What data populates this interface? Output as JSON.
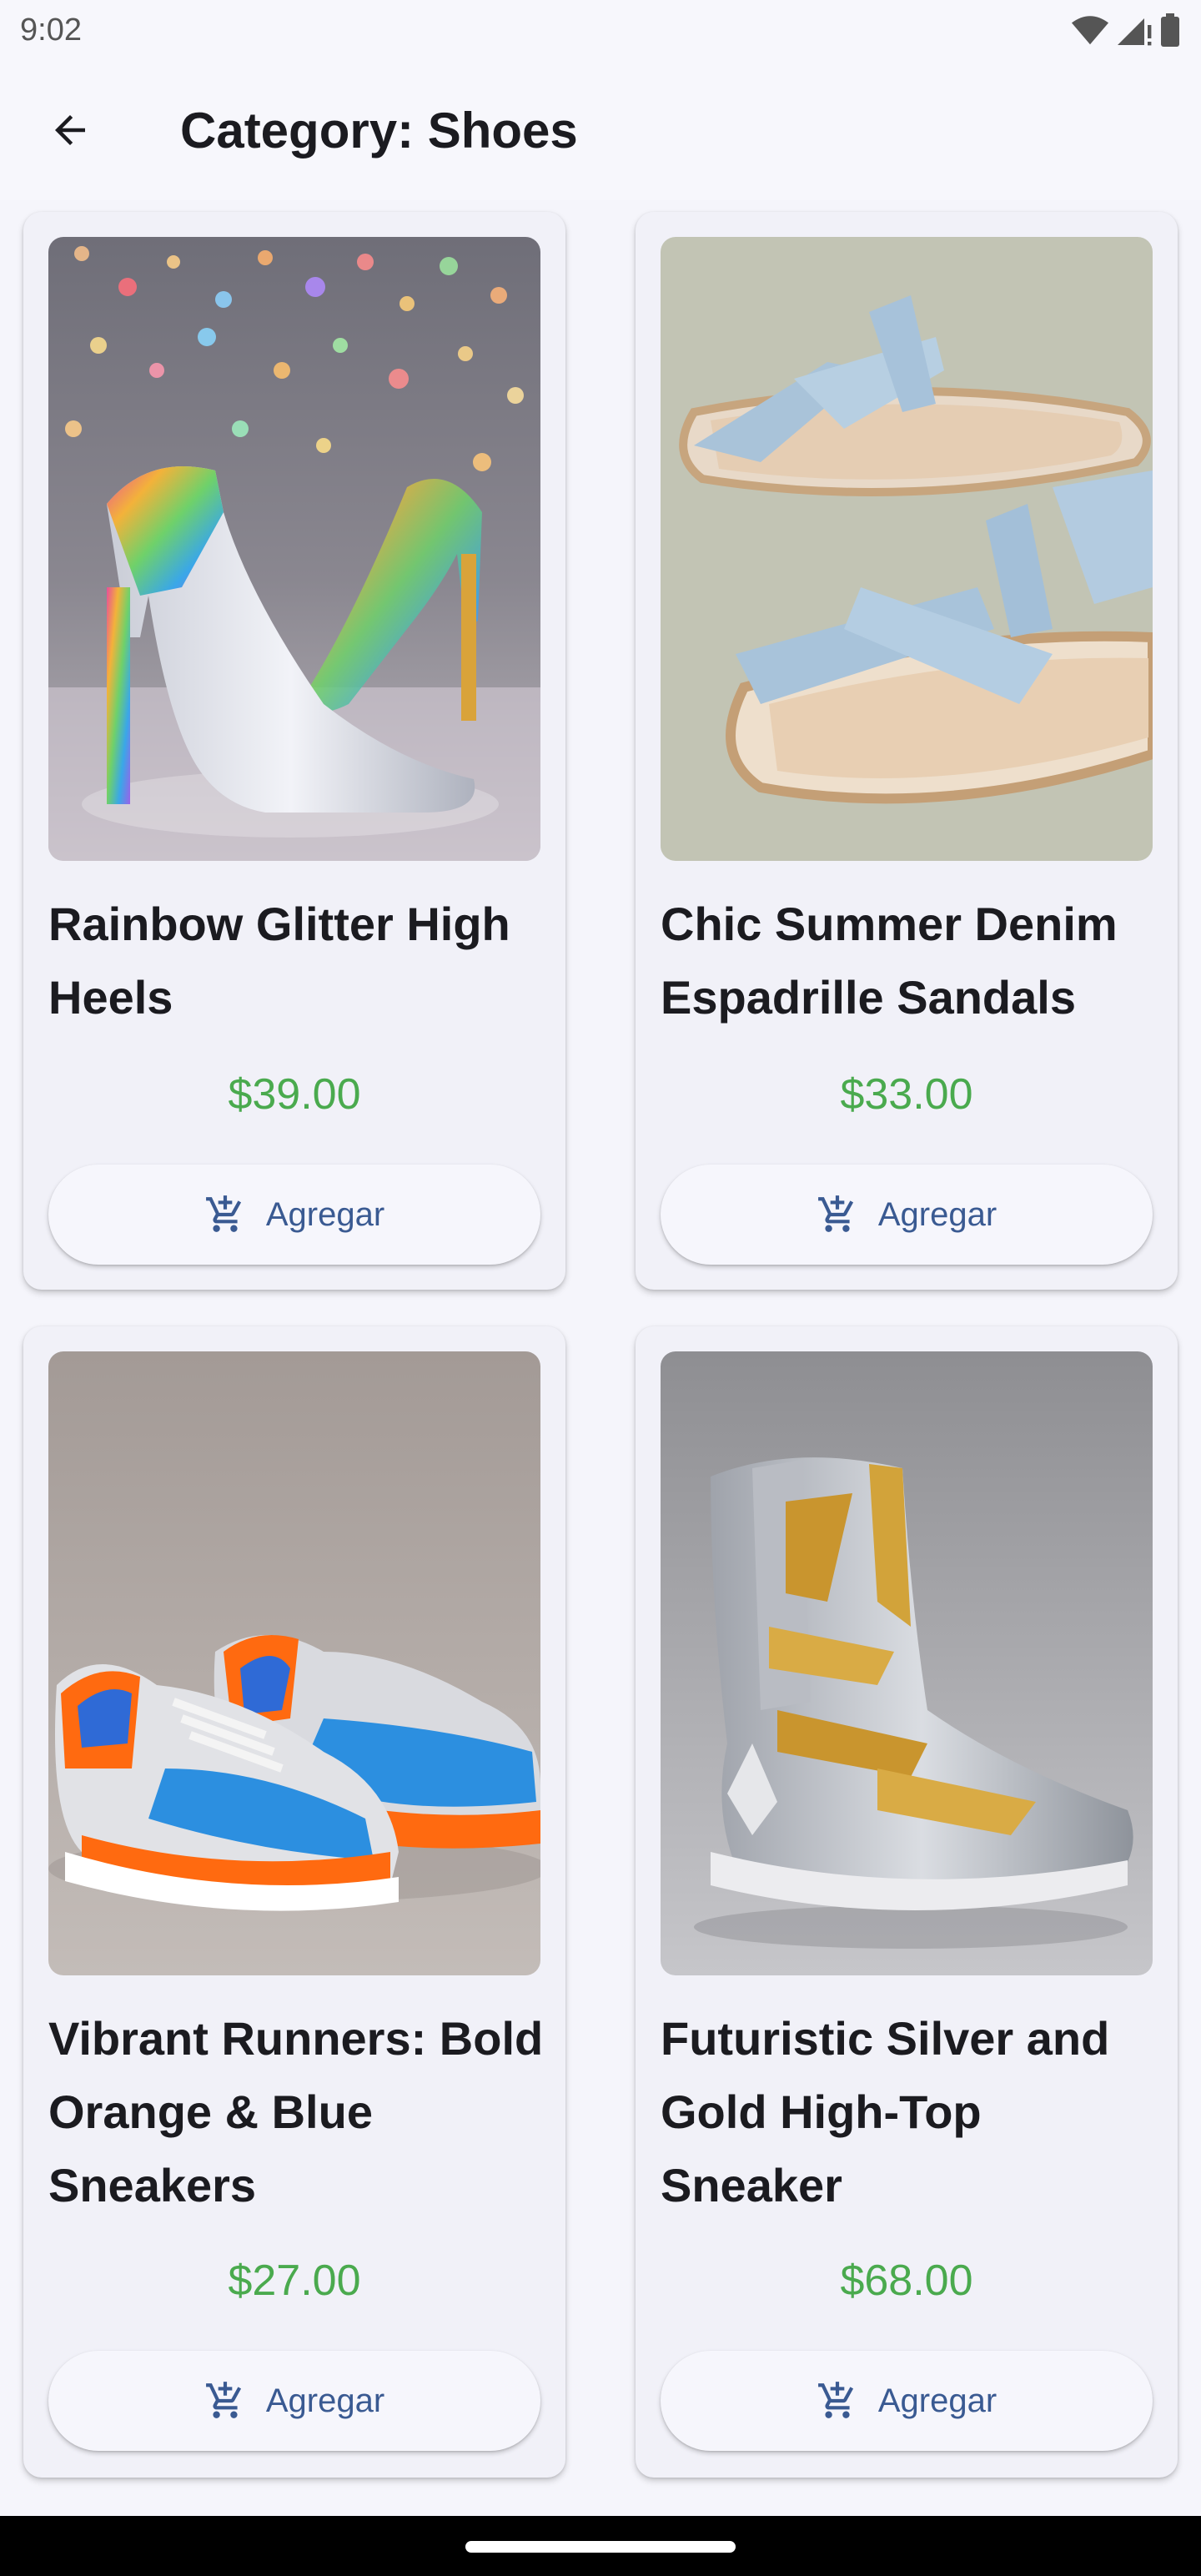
{
  "status_bar": {
    "time": "9:02"
  },
  "app_bar": {
    "title": "Category: Shoes"
  },
  "products": [
    {
      "title": "Rainbow Glitter High Heels",
      "price": "$39.00",
      "button_label": "Agregar"
    },
    {
      "title": "Chic Summer Denim Espadrille Sandals",
      "price": "$33.00",
      "button_label": "Agregar"
    },
    {
      "title": "Vibrant Runners: Bold Orange & Blue Sneakers",
      "price": "$27.00",
      "button_label": "Agregar"
    },
    {
      "title": "Futuristic Silver and Gold High-Top Sneaker",
      "price": "$68.00",
      "button_label": "Agregar"
    }
  ],
  "colors": {
    "price": "#4aaa4e",
    "button_text": "#3a5a92",
    "background": "#f7f7fc"
  },
  "icons": [
    "wifi-icon",
    "signal-icon",
    "battery-icon",
    "back-arrow-icon",
    "add-cart-icon"
  ]
}
